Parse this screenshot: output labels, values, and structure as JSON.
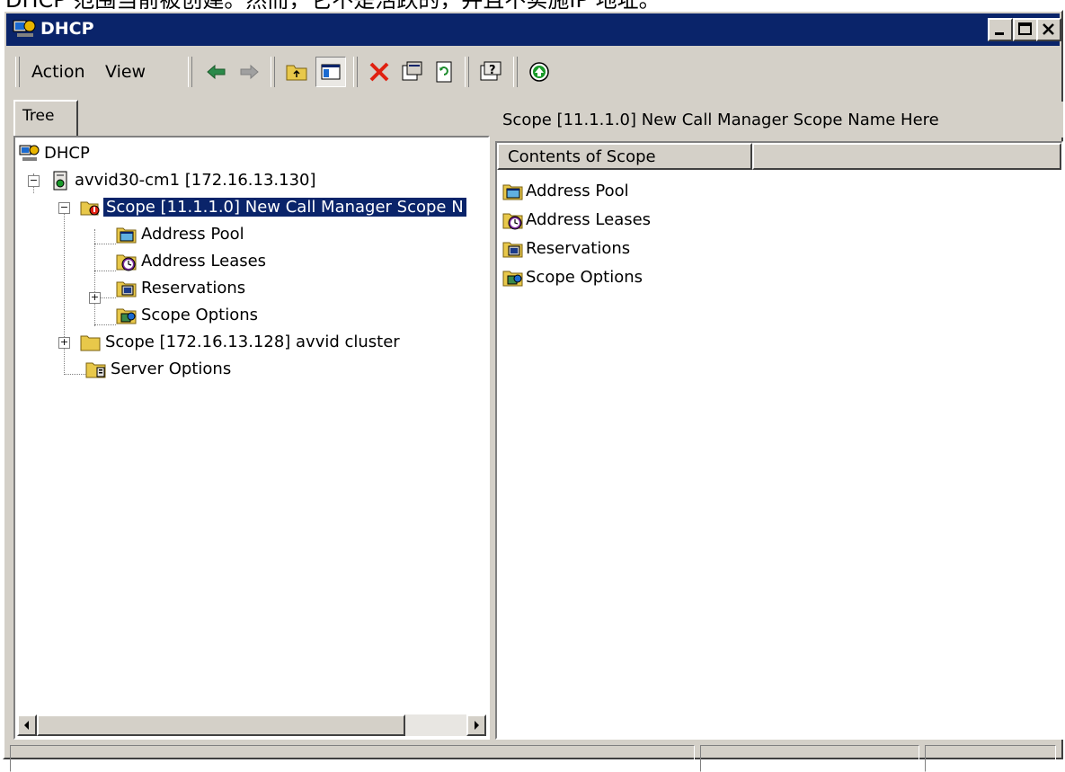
{
  "caption": "DHCP 范围当前被创建。然而，它不是活跃的，并且不实施IP 地址。",
  "window": {
    "title": "DHCP"
  },
  "menu": {
    "action": "Action",
    "view": "View"
  },
  "toolbar_icons": [
    "back-arrow-icon",
    "forward-arrow-icon",
    "up-folder-icon",
    "show-hide-tree-icon",
    "delete-icon",
    "properties-icon",
    "refresh-icon",
    "help-icon",
    "activate-icon"
  ],
  "tree": {
    "tab_label": "Tree",
    "root": "DHCP",
    "server": "avvid30-cm1 [172.16.13.130]",
    "scope1": "Scope [11.1.1.0] New Call Manager Scope N",
    "scope1_children": [
      "Address Pool",
      "Address Leases",
      "Reservations",
      "Scope Options"
    ],
    "scope2": "Scope [172.16.13.128] avvid cluster",
    "server_options": "Server Options"
  },
  "details": {
    "header": "Scope [11.1.1.0] New Call Manager Scope Name Here",
    "column": "Contents of Scope",
    "items": [
      "Address Pool",
      "Address Leases",
      "Reservations",
      "Scope Options"
    ]
  },
  "colors": {
    "titlebar": "#0a246a",
    "selection": "#0a246a",
    "face": "#d4d0c8"
  }
}
